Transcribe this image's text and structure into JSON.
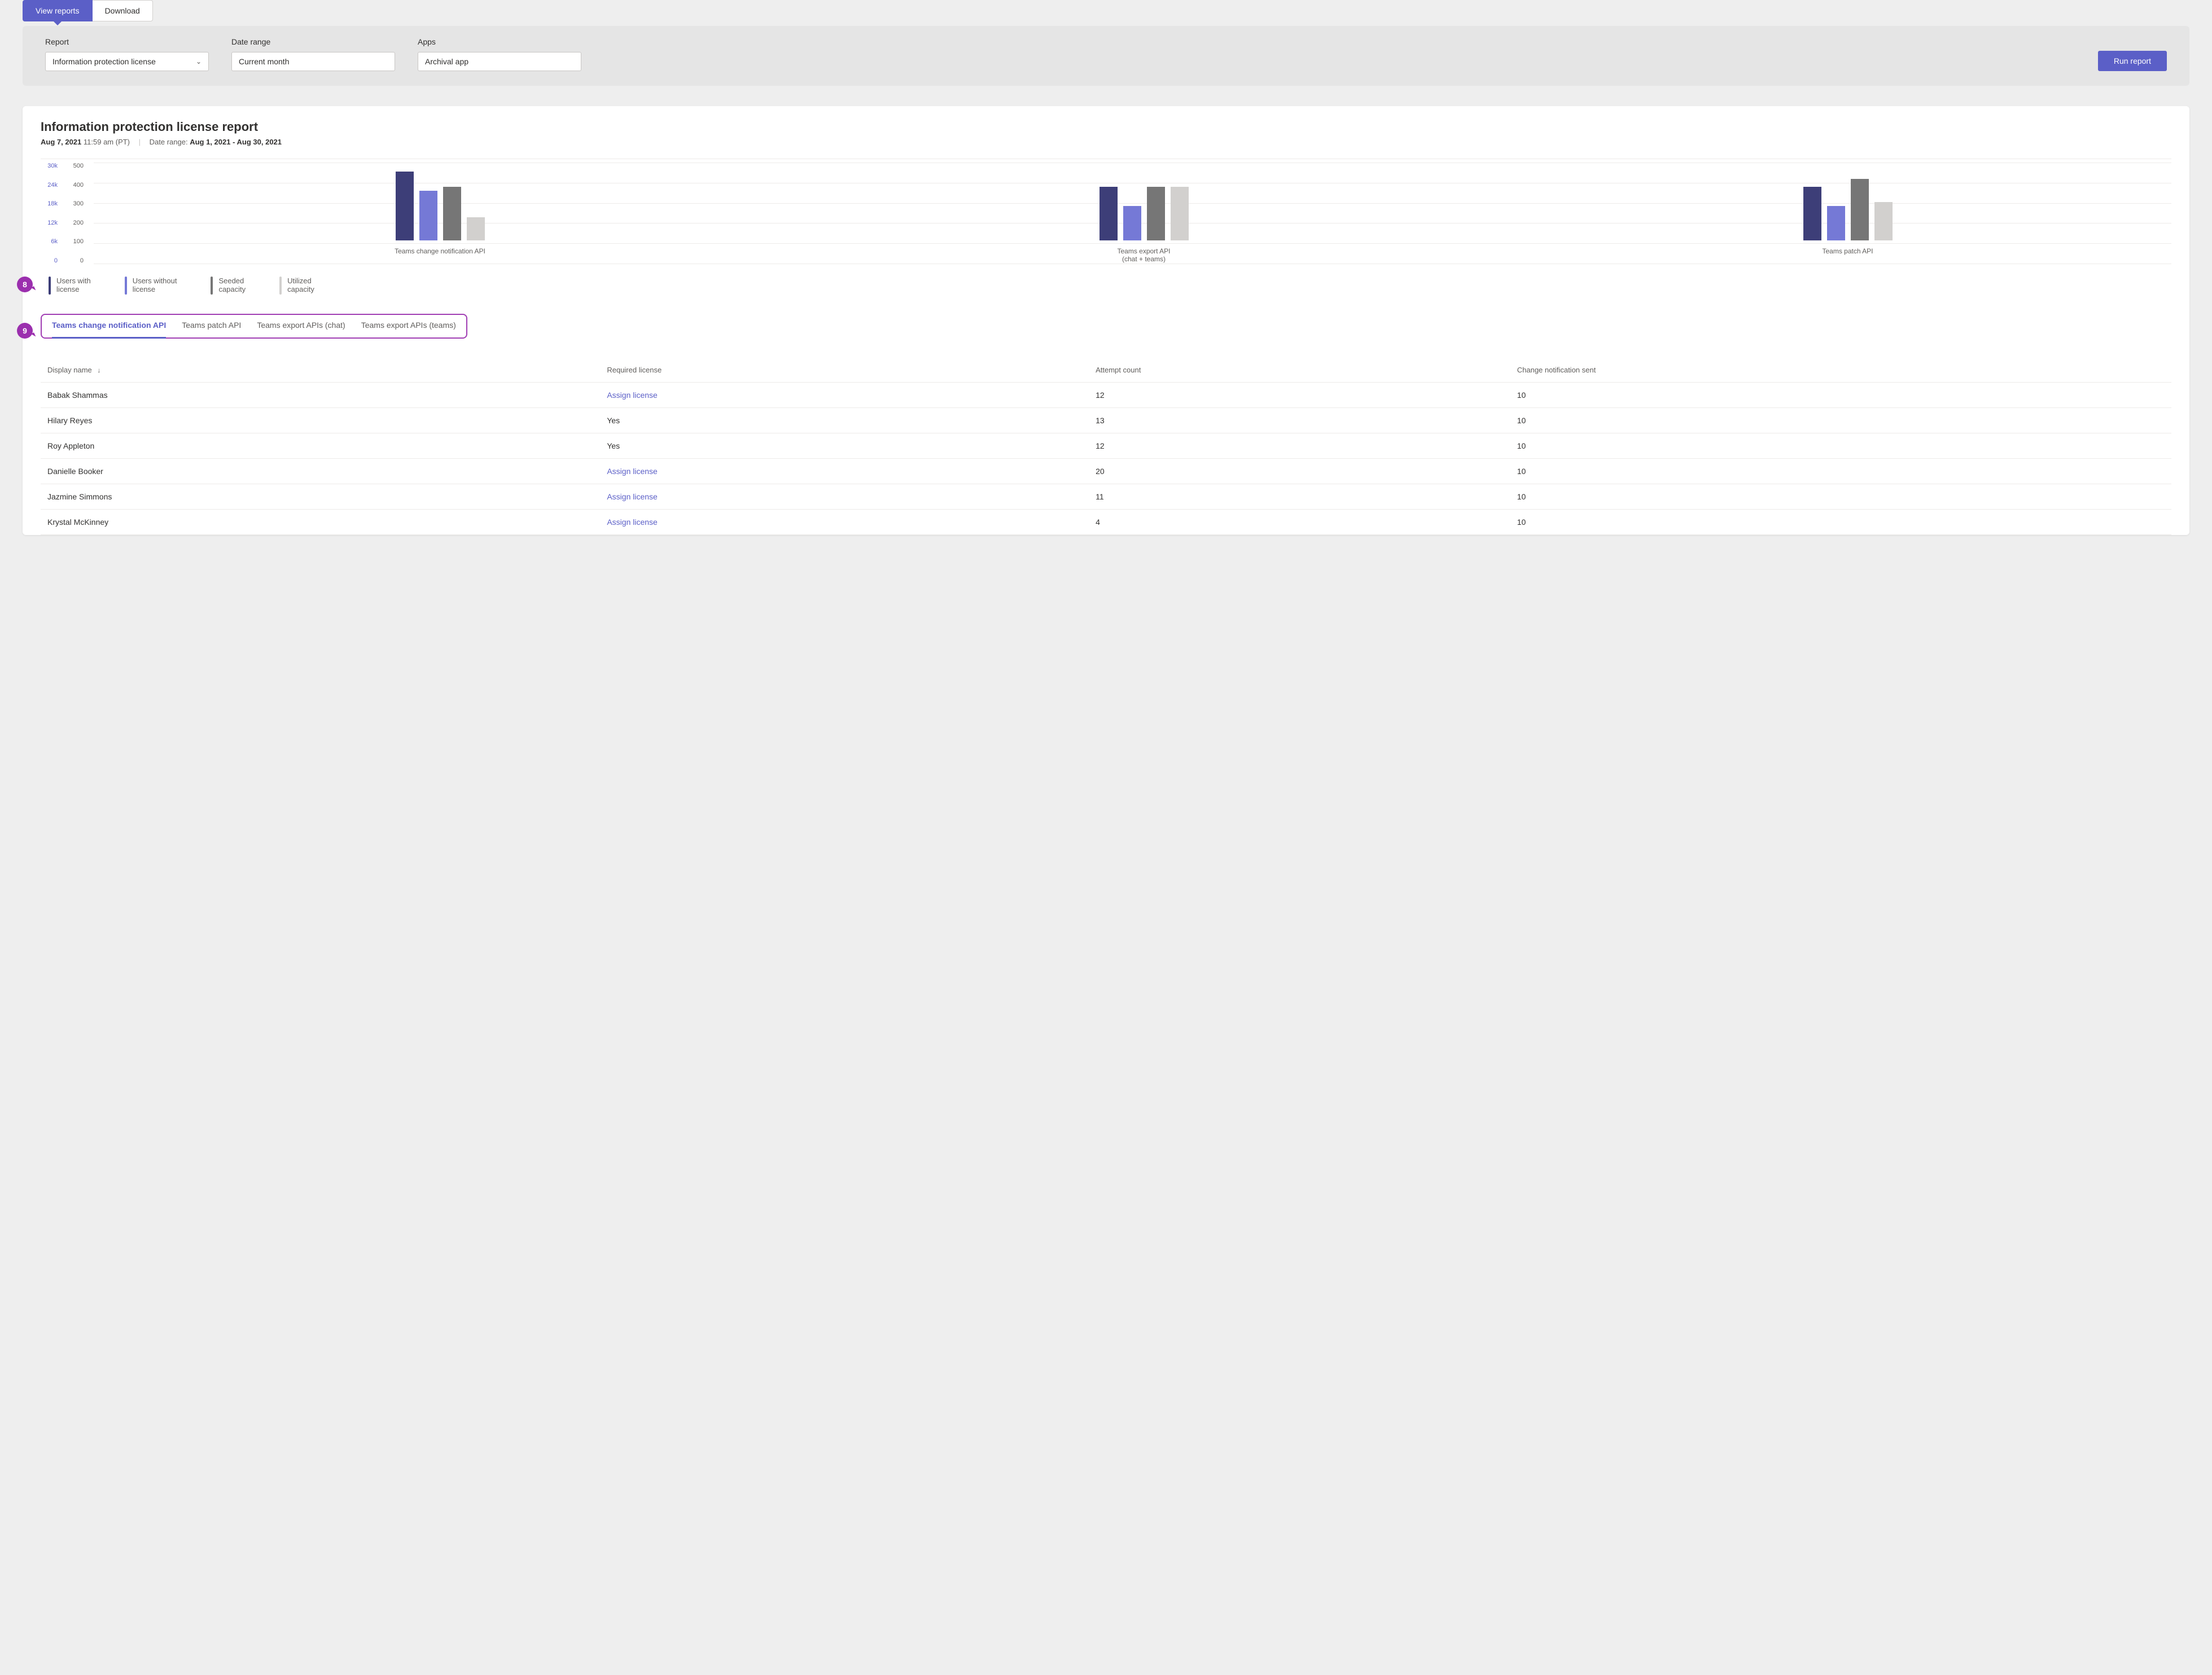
{
  "top_tabs": {
    "view_reports": "View reports",
    "download": "Download"
  },
  "filters": {
    "report_label": "Report",
    "report_value": "Information protection license",
    "date_label": "Date range",
    "date_value": "Current month",
    "apps_label": "Apps",
    "apps_value": "Archival app",
    "run": "Run report"
  },
  "report": {
    "title": "Information protection license report",
    "date_bold": "Aug 7, 2021",
    "time": "11:59 am (PT)",
    "range_prefix": "Date range: ",
    "range_value": "Aug 1, 2021 - Aug 30, 2021"
  },
  "chart_data": {
    "type": "bar",
    "y_axis_primary": {
      "ticks": [
        "30k",
        "24k",
        "18k",
        "12k",
        "6k",
        "0"
      ],
      "range": [
        0,
        30000
      ]
    },
    "y_axis_secondary": {
      "ticks": [
        "500",
        "400",
        "300",
        "200",
        "100",
        "0"
      ],
      "range": [
        0,
        500
      ]
    },
    "categories": [
      "Teams change notification API",
      "Teams export API\n(chat + teams)",
      "Teams patch API"
    ],
    "series": [
      {
        "name": "Users with license",
        "color": "#3d3e78",
        "values": [
          360,
          280,
          280
        ]
      },
      {
        "name": "Users without license",
        "color": "#7579d6",
        "values": [
          260,
          180,
          180
        ]
      },
      {
        "name": "Seeded capacity",
        "color": "#767676",
        "values": [
          280,
          280,
          320
        ]
      },
      {
        "name": "Utilized capacity",
        "color": "#d2d0ce",
        "values": [
          120,
          280,
          200
        ]
      }
    ],
    "value_max": 500
  },
  "legend": {
    "items": [
      {
        "l1": "Users with",
        "l2": "license"
      },
      {
        "l1": "Users without",
        "l2": "license"
      },
      {
        "l1": "Seeded",
        "l2": "capacity"
      },
      {
        "l1": "Utilized",
        "l2": "capacity"
      }
    ]
  },
  "callouts": {
    "legend": "8",
    "subtabs": "9"
  },
  "subtabs": [
    "Teams change notification API",
    "Teams patch API",
    "Teams export APIs (chat)",
    "Teams export APIs (teams)"
  ],
  "table": {
    "headers": {
      "display_name": "Display name",
      "required": "Required license",
      "attempts": "Attempt count",
      "sent": "Change notification sent"
    },
    "assign_label": "Assign license",
    "rows": [
      {
        "name": "Babak Shammas",
        "required": "Assign license",
        "is_link": true,
        "attempts": "12",
        "sent": "10"
      },
      {
        "name": "Hilary Reyes",
        "required": "Yes",
        "is_link": false,
        "attempts": "13",
        "sent": "10"
      },
      {
        "name": "Roy Appleton",
        "required": "Yes",
        "is_link": false,
        "attempts": "12",
        "sent": "10"
      },
      {
        "name": "Danielle Booker",
        "required": "Assign license",
        "is_link": true,
        "attempts": "20",
        "sent": "10"
      },
      {
        "name": "Jazmine Simmons",
        "required": "Assign license",
        "is_link": true,
        "attempts": "11",
        "sent": "10"
      },
      {
        "name": "Krystal McKinney",
        "required": "Assign license",
        "is_link": true,
        "attempts": "4",
        "sent": "10"
      }
    ]
  }
}
